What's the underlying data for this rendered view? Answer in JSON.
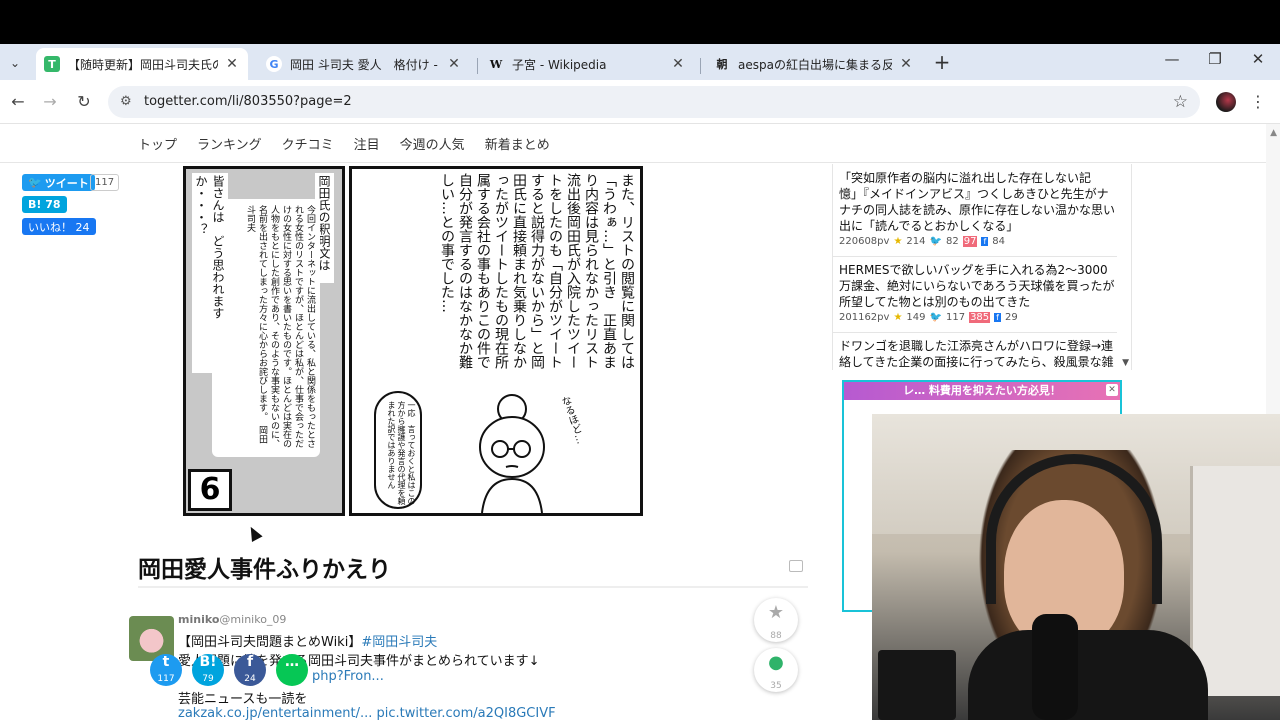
{
  "tabs": [
    {
      "title": "【随時更新】岡田斗司夫氏の暴露",
      "favicon": "T",
      "active": true
    },
    {
      "title": "岡田 斗司夫 愛人　格付け - Go",
      "favicon": "G"
    },
    {
      "title": "子宮 - Wikipedia",
      "favicon": "W"
    },
    {
      "title": "aespaの紅白出場に集まる反対署",
      "favicon": "朝"
    }
  ],
  "toolbar": {
    "url": "togetter.com/li/803550?page=2"
  },
  "sitenav": [
    "トップ",
    "ランキング",
    "クチコミ",
    "注目",
    "今週の人気",
    "新着まとめ"
  ],
  "share": {
    "tweet_label": "ツイート",
    "tweet_count": "117",
    "hatena_label": "B! 78",
    "like_label": "いいね！ 24"
  },
  "manga": {
    "left_title": "岡田氏の釈明文は",
    "left_body": "今回インターネットに流出している、私と関係をもったとされる女性のリストですが、ほとんどは私が、仕事で会っただけの女性に対する思いを書いたものです。ほとんどは実在の人物をもとにした創作であり、そのような事実もないのに、名前を出されてしまった方々に心からお詫びします。　岡田斗司夫",
    "left_question": "皆さんは　どう思われますか・・・？",
    "panel_number": "6",
    "right_text": "また、リストの閲覧に関しては「うわぁ…」と引き　正直あまり内容は見られなかったリスト流出後岡田氏が入院したツイートをしたのも「自分がツイートすると説得力がないから」と岡田氏に直接頼まれ気乗りしなかったがツイートしたもの現在所属する会社の事もありこの件で自分が発言するのはなかなか難しい…との事でした…",
    "bubble_text": "一応　言っておくと私はこの方から擁護や発言の代理を頼まれた訳ではありません",
    "naruhodo": "なるほど…"
  },
  "section": {
    "title": "岡田愛人事件ふりかえり"
  },
  "tweet": {
    "user_name": "miniko",
    "user_handle": "@miniko_09",
    "line1_text": "【岡田斗司夫問題まとめWiki】",
    "line1_tag": "#岡田斗司夫",
    "line2": "愛人問題に端を発する岡田斗司夫事件がまとめられています↓",
    "line3_link": "php?Fron...",
    "line4": "芸能ニュースも一読を",
    "line5_link1": "zakzak.co.jp/entertainment/...",
    "line5_link2": "pic.twitter.com/a2QI8GCIVF",
    "fav_count": "88",
    "reply_count": "35"
  },
  "float_share": [
    {
      "label": "t",
      "count": "117",
      "color": "#1d9bf0"
    },
    {
      "label": "B!",
      "count": "79",
      "color": "#00a4de"
    },
    {
      "label": "f",
      "count": "24",
      "color": "#3b5998"
    },
    {
      "label": "…",
      "count": "",
      "color": "#06c755"
    }
  ],
  "related": [
    {
      "title": "「突如原作者の脳内に溢れ出した存在しない記憶」『メイドインアビス』つくしあきひと先生がナナチの同人誌を読み、原作に存在しない温かな思い出に「読んでるとおかしくなる」",
      "pv": "220608pv",
      "stars": "214",
      "tweets": "82",
      "hatena": "97",
      "fb": "84"
    },
    {
      "title": "HERMESで欲しいバッグを手に入れる為2〜3000万課金、絶対にいらないであろう天球儀を買ったが所望してた物とは別のもの出てきた",
      "pv": "201162pv",
      "stars": "149",
      "tweets": "117",
      "hatena": "385",
      "fb": "29"
    },
    {
      "title": "ドワンゴを退職した江添亮さんがハロワに登録→連絡してきた企業の面接に行ってみたら、殺風景な雑居ビ"
    }
  ],
  "ad": {
    "head": "レ… 料費用を抑えたい方必見！"
  },
  "colors": {
    "tab_strip": "#dfe7f3",
    "accent_twitter": "#1d9bf0",
    "accent_hatena": "#00a4de",
    "accent_facebook": "#1877f2",
    "link": "#2a7ab8"
  }
}
